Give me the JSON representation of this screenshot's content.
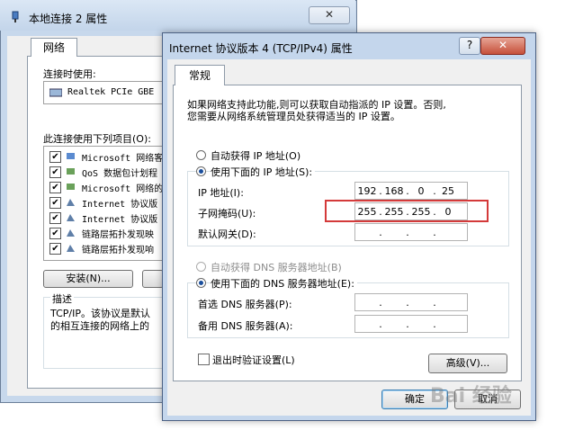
{
  "background_window": {
    "title": "本地连接 2 属性",
    "close_label": "✕",
    "tab_network": "网络",
    "connect_using_label": "连接时使用:",
    "adapter_name": "Realtek PCIe GBE",
    "items_label": "此连接使用下列项目(O):",
    "items": [
      {
        "label": "Microsoft 网络客",
        "checked": true
      },
      {
        "label": "QoS 数据包计划程",
        "checked": true
      },
      {
        "label": "Microsoft 网络的",
        "checked": true
      },
      {
        "label": "Internet 协议版",
        "checked": true
      },
      {
        "label": "Internet 协议版",
        "checked": true
      },
      {
        "label": "链路层拓扑发现映",
        "checked": true
      },
      {
        "label": "链路层拓扑发现响",
        "checked": true
      }
    ],
    "install_label": "安装(N)...",
    "description_label": "描述",
    "description_line1": "TCP/IP。该协议是默认",
    "description_line2": "的相互连接的网络上的"
  },
  "dialog": {
    "title": "Internet 协议版本 4 (TCP/IPv4) 属性",
    "help_label": "?",
    "close_label": "✕",
    "tab_general": "常规",
    "intro_line1": "如果网络支持此功能,则可以获取自动指派的 IP 设置。否则,",
    "intro_line2": "您需要从网络系统管理员处获得适当的 IP 设置。",
    "auto_ip_label": "自动获得 IP 地址(O)",
    "use_ip_label": "使用下面的 IP 地址(S):",
    "ip_address_label": "IP 地址(I):",
    "ip_address": [
      "192",
      "168",
      "0",
      "25"
    ],
    "subnet_label": "子网掩码(U):",
    "subnet_mask": [
      "255",
      "255",
      "255",
      "0"
    ],
    "gateway_label": "默认网关(D):",
    "gateway": [
      "",
      "",
      "",
      ""
    ],
    "auto_dns_label": "自动获得 DNS 服务器地址(B)",
    "use_dns_label": "使用下面的 DNS 服务器地址(E):",
    "preferred_dns_label": "首选 DNS 服务器(P):",
    "preferred_dns": [
      "",
      "",
      "",
      ""
    ],
    "alternate_dns_label": "备用 DNS 服务器(A):",
    "alternate_dns": [
      "",
      "",
      "",
      ""
    ],
    "validate_label": "退出时验证设置(L)",
    "validate_checked": false,
    "advanced_label": "高级(V)...",
    "ok_label": "确定",
    "cancel_label": "取消",
    "selected_ip_mode": "manual",
    "selected_dns_mode": "manual"
  },
  "overlay": {
    "watermark": "Bai 经验"
  },
  "colors": {
    "highlight_box": "#d43a3a",
    "title_bar": "#c4d6ec"
  }
}
